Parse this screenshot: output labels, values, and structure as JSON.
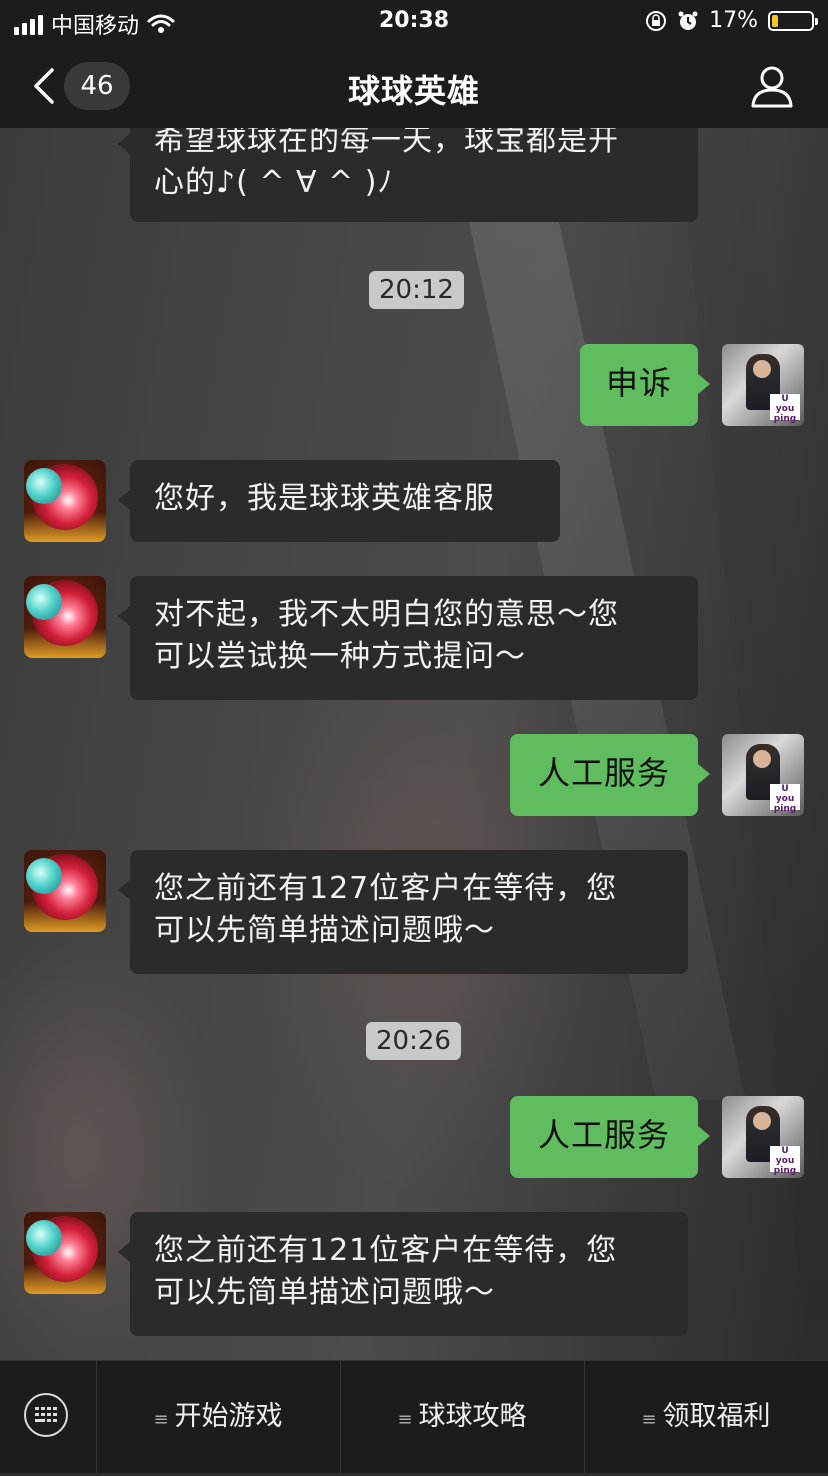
{
  "status_bar": {
    "carrier": "中国移动",
    "time": "20:38",
    "battery_text": "17%",
    "battery_level": 0.17,
    "icons": [
      "signal-icon",
      "wifi-icon",
      "orientation-lock-icon",
      "alarm-icon",
      "battery-icon"
    ]
  },
  "nav": {
    "back_icon": "chevron-left-icon",
    "unread_count": "46",
    "title": "球球英雄",
    "profile_icon": "person-icon"
  },
  "messages": [
    {
      "type": "in",
      "text_line1": "希望球球在的每一天，球宝都是开",
      "text_line2": "心的♪( ^ ∀ ^ )ﾉ"
    },
    {
      "type": "time",
      "text": "20:12"
    },
    {
      "type": "out",
      "text": "申诉"
    },
    {
      "type": "in",
      "text": "您好，我是球球英雄客服"
    },
    {
      "type": "in",
      "text_line1": "对不起，我不太明白您的意思～您",
      "text_line2": "可以尝试换一种方式提问～"
    },
    {
      "type": "out",
      "text": "人工服务"
    },
    {
      "type": "in",
      "text_line1": "您之前还有127位客户在等待，您",
      "text_line2": "可以先简单描述问题哦～"
    },
    {
      "type": "time",
      "text": "20:26"
    },
    {
      "type": "out",
      "text": "人工服务"
    },
    {
      "type": "in",
      "text_line1": "您之前还有121位客户在等待，您",
      "text_line2": "可以先简单描述问题哦～"
    }
  ],
  "user_avatar_logo": {
    "line1": "U",
    "line2": "you ping"
  },
  "bottom_menu": {
    "keyboard_icon": "keyboard-icon",
    "items": [
      {
        "icon": "menu-lines-icon",
        "label": "开始游戏"
      },
      {
        "icon": "menu-lines-icon",
        "label": "球球攻略"
      },
      {
        "icon": "menu-lines-icon",
        "label": "领取福利"
      }
    ]
  },
  "colors": {
    "bar_bg": "#1c1c1c",
    "incoming_bubble": "#2b2b2b",
    "outgoing_bubble": "#5fbd5f",
    "timestamp_bg": "#c9c9c9",
    "battery_fill": "#f3c623"
  }
}
